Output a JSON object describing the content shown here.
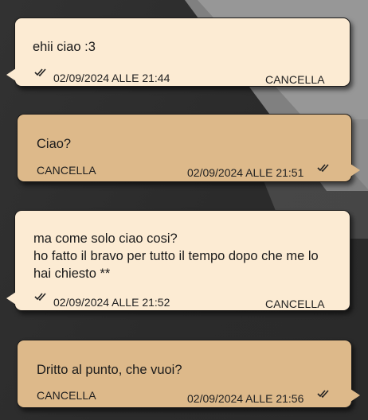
{
  "messages": [
    {
      "direction": "in",
      "text": "ehii ciao :3",
      "timestamp": "02/09/2024 ALLE 21:44",
      "delete_label": "CANCELLA",
      "read_icon": "double-check-icon"
    },
    {
      "direction": "out",
      "text": "Ciao?",
      "timestamp": "02/09/2024 ALLE 21:51",
      "delete_label": "CANCELLA",
      "read_icon": "double-check-icon"
    },
    {
      "direction": "in",
      "text": "ma come solo ciao cosi?\nho fatto il bravo per tutto il tempo dopo che me lo hai chiesto **",
      "timestamp": "02/09/2024 ALLE 21:52",
      "delete_label": "CANCELLA",
      "read_icon": "double-check-icon"
    },
    {
      "direction": "out",
      "text": "Dritto al punto, che vuoi?",
      "timestamp": "02/09/2024 ALLE 21:56",
      "delete_label": "CANCELLA",
      "read_icon": "double-check-icon"
    }
  ],
  "colors": {
    "incoming_bubble": "#fcebd3",
    "outgoing_bubble": "#ddb98a",
    "background": "#2b2b2b"
  }
}
